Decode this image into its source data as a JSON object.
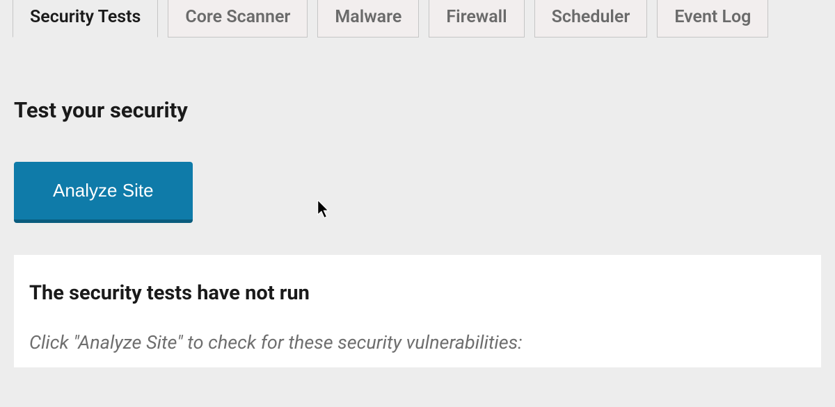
{
  "tabs": [
    {
      "label": "Security Tests",
      "active": true
    },
    {
      "label": "Core Scanner",
      "active": false
    },
    {
      "label": "Malware",
      "active": false
    },
    {
      "label": "Firewall",
      "active": false
    },
    {
      "label": "Scheduler",
      "active": false
    },
    {
      "label": "Event Log",
      "active": false
    }
  ],
  "heading": "Test your security",
  "analyze_button": "Analyze Site",
  "panel": {
    "title": "The security tests have not run",
    "description": "Click \"Analyze Site\" to check for these security vulnerabilities:"
  }
}
